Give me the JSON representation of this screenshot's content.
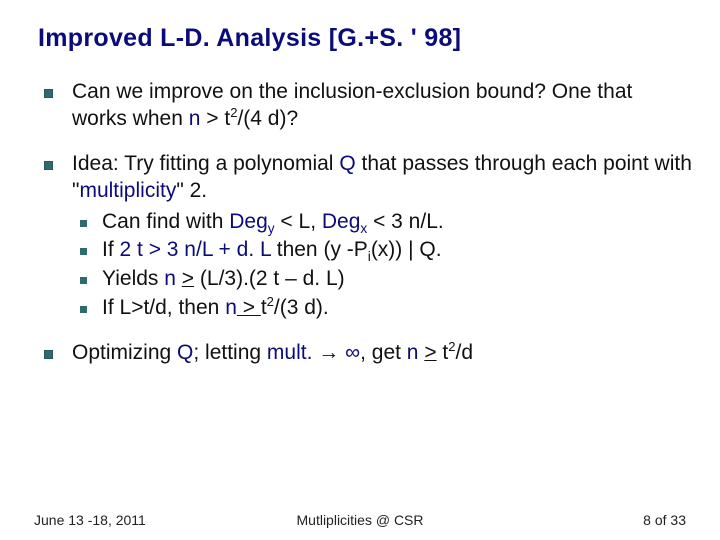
{
  "title": "Improved L-D. Analysis [G.+S. ' 98]",
  "bullets": {
    "b1_pre": "Can we improve on the inclusion-exclusion bound? One that works when ",
    "b1_cond_n": "n",
    "b1_cond_gt": " > t",
    "b1_cond_sup": "2",
    "b1_cond_tail": "/(4 d)?",
    "b2_pre": "Idea: Try fitting a polynomial ",
    "b2_Q": "Q",
    "b2_mid": " that passes through each point with \"",
    "b2_mult": "multiplicity",
    "b2_post": "\" 2.",
    "s1_a": "Can find with ",
    "s1_degy": "Deg",
    "s1_y": "y",
    "s1_lt1": " < L, ",
    "s1_degx": "Deg",
    "s1_x": "x",
    "s1_lt2": " < 3 n/L.",
    "s2_a": "If ",
    "s2_cond": "2 t > 3 n/L + d. L",
    "s2_then": " then ",
    "s2_tail": "(y -P",
    "s2_i": "i",
    "s2_tail2": "(x)) | Q.",
    "s3_a": "Yields ",
    "s3_n": "n",
    "s3_ge": " ",
    "s3_geq": ">",
    "s3_rhs": " (L/3).(2 t – d. L)",
    "s4_a": "If ",
    "s4_cond": "L>t/d, then ",
    "s4_n": "n",
    "s4_geq": " > ",
    "s4_t": "t",
    "s4_sup": "2",
    "s4_tail": "/(3 d).",
    "b3_a": "Optimizing ",
    "b3_Q": "Q",
    "b3_mid": "; letting ",
    "b3_mult": "mult.",
    "b3_arrow": " → ",
    "b3_inf": "∞",
    "b3_get": ", get ",
    "b3_n": "n",
    "b3_ge": " ",
    "b3_geq": ">",
    "b3_t": " t",
    "b3_sup": "2",
    "b3_tail": "/d"
  },
  "footer": {
    "left": "June 13 -18, 2011",
    "center": "Mutliplicities @ CSR",
    "right": "8 of 33"
  }
}
